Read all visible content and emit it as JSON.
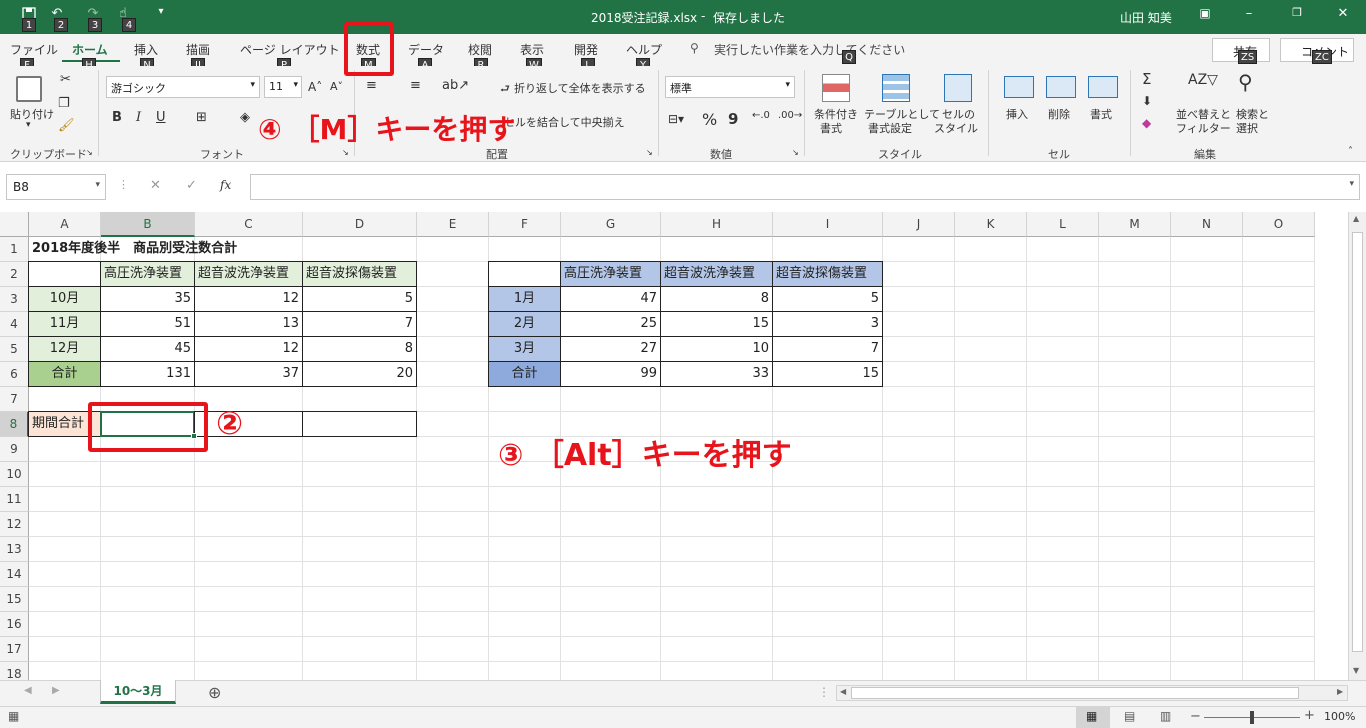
{
  "title": {
    "filename": "2018受注記録.xlsx",
    "sep": "-",
    "saved": "保存しました",
    "user": "山田 知美"
  },
  "qat": {
    "save_key": "1",
    "undo_key": "2",
    "redo_key": "3",
    "touch_key": "4"
  },
  "tabs": [
    {
      "label": "ファイル",
      "key": "F"
    },
    {
      "label": "ホーム",
      "key": "H"
    },
    {
      "label": "挿入",
      "key": "N"
    },
    {
      "label": "描画",
      "key": "JI"
    },
    {
      "label": "ページ レイアウト",
      "key": "P"
    },
    {
      "label": "数式",
      "key": "M"
    },
    {
      "label": "データ",
      "key": "A"
    },
    {
      "label": "校閲",
      "key": "R"
    },
    {
      "label": "表示",
      "key": "W"
    },
    {
      "label": "開発",
      "key": "L"
    },
    {
      "label": "ヘルプ",
      "key": "Y"
    }
  ],
  "tellme": {
    "text": "実行したい作業を入力してください",
    "key": "Q"
  },
  "share": {
    "label": "共有",
    "key": "ZS"
  },
  "comment": {
    "label": "コメント",
    "key": "ZC"
  },
  "ribbon": {
    "paste": "貼り付け",
    "clipboard": "クリップボード",
    "font_name": "游ゴシック",
    "font_size": "11",
    "font": "フォント",
    "wrap": "折り返して全体を表示する",
    "merge": "セルを結合して中央揃え",
    "align": "配置",
    "numfmt": "標準",
    "number": "数値",
    "cond1": "条件付き",
    "cond2": "書式",
    "table1": "テーブルとして",
    "table2": "書式設定",
    "cellstyle1": "セルの",
    "cellstyle2": "スタイル",
    "style": "スタイル",
    "insert": "挿入",
    "delete": "削除",
    "format": "書式",
    "cells": "セル",
    "sort1": "並べ替えと",
    "sort2": "フィルター",
    "find1": "検索と",
    "find2": "選択",
    "edit": "編集",
    "bold": "B",
    "italic": "I",
    "underline": "U",
    "percent": "%",
    "comma": "9"
  },
  "formula": {
    "namebox": "B8",
    "fx": "fx",
    "value": ""
  },
  "columns": [
    "A",
    "B",
    "C",
    "D",
    "E",
    "F",
    "G",
    "H",
    "I",
    "J",
    "K",
    "L",
    "M",
    "N",
    "O"
  ],
  "rows": [
    "1",
    "2",
    "3",
    "4",
    "5",
    "6",
    "7",
    "8",
    "9",
    "10",
    "11",
    "12",
    "13",
    "14",
    "15",
    "16",
    "17",
    "18"
  ],
  "table1": {
    "title": "2018年度後半　商品別受注数合計",
    "headers": [
      "高圧洗浄装置",
      "超音波洗浄装置",
      "超音波探傷装置"
    ],
    "rows": [
      {
        "label": "10月",
        "values": [
          "35",
          "12",
          "5"
        ]
      },
      {
        "label": "11月",
        "values": [
          "51",
          "13",
          "7"
        ]
      },
      {
        "label": "12月",
        "values": [
          "45",
          "12",
          "8"
        ]
      },
      {
        "label": "合計",
        "values": [
          "131",
          "37",
          "20"
        ]
      }
    ],
    "period_label": "期間合計"
  },
  "table2": {
    "headers": [
      "高圧洗浄装置",
      "超音波洗浄装置",
      "超音波探傷装置"
    ],
    "rows": [
      {
        "label": "1月",
        "values": [
          "47",
          "8",
          "5"
        ]
      },
      {
        "label": "2月",
        "values": [
          "25",
          "15",
          "3"
        ]
      },
      {
        "label": "3月",
        "values": [
          "27",
          "10",
          "7"
        ]
      },
      {
        "label": "合計",
        "values": [
          "99",
          "33",
          "15"
        ]
      }
    ]
  },
  "sheet": {
    "tab": "10～3月"
  },
  "status": {
    "zoom": "100%"
  },
  "annotations": {
    "a4": "④ ［M］キーを押す",
    "a2": "②",
    "a3": "③ ［Alt］キーを押す"
  },
  "colors": {
    "excel_green": "#217346",
    "header_green": "#e2efda",
    "total_green": "#a9d08e",
    "blue_light": "#b4c6e7",
    "blue_dark": "#8ea9db",
    "peach": "#fce4d6",
    "red": "#e8141b"
  }
}
